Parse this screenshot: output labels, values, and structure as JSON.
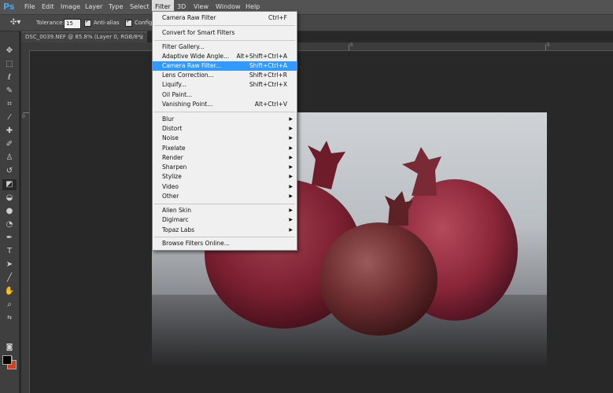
{
  "menubar": {
    "logo": "Ps",
    "items": [
      "File",
      "Edit",
      "Image",
      "Layer",
      "Type",
      "Select",
      "Filter",
      "3D",
      "View",
      "Window",
      "Help"
    ]
  },
  "options": {
    "tolerance_label": "Tolerance:",
    "tolerance_value": "15",
    "antialias_label": "Anti-alias",
    "contiguous_label": "Configu"
  },
  "document": {
    "tab_title": "DSC_0039.NEF @ 85.8% (Layer 0, RGB/8*) *",
    "close": "×"
  },
  "rulers": {
    "top_labels": [
      "0",
      "5",
      "5"
    ],
    "left_labels": [
      "0"
    ]
  },
  "filter_menu": {
    "items": [
      {
        "label": "Camera Raw Filter",
        "shortcut": "Ctrl+F"
      },
      {
        "label": "Convert for Smart Filters"
      },
      {
        "label": "Filter Gallery..."
      },
      {
        "label": "Adaptive Wide Angle...",
        "shortcut": "Alt+Shift+Ctrl+A"
      },
      {
        "label": "Camera Raw Filter...",
        "shortcut": "Shift+Ctrl+A"
      },
      {
        "label": "Lens Correction...",
        "shortcut": "Shift+Ctrl+R"
      },
      {
        "label": "Liquify...",
        "shortcut": "Shift+Ctrl+X"
      },
      {
        "label": "Oil Paint..."
      },
      {
        "label": "Vanishing Point...",
        "shortcut": "Alt+Ctrl+V"
      },
      {
        "label": "Blur"
      },
      {
        "label": "Distort"
      },
      {
        "label": "Noise"
      },
      {
        "label": "Pixelate"
      },
      {
        "label": "Render"
      },
      {
        "label": "Sharpen"
      },
      {
        "label": "Stylize"
      },
      {
        "label": "Video"
      },
      {
        "label": "Other"
      },
      {
        "label": "Alien Skin"
      },
      {
        "label": "Digimarc"
      },
      {
        "label": "Topaz Labs"
      },
      {
        "label": "Browse Filters Online..."
      }
    ]
  },
  "colors": {
    "highlight": "#3399ff",
    "foreground": "#000000",
    "background": "#c9461c"
  }
}
